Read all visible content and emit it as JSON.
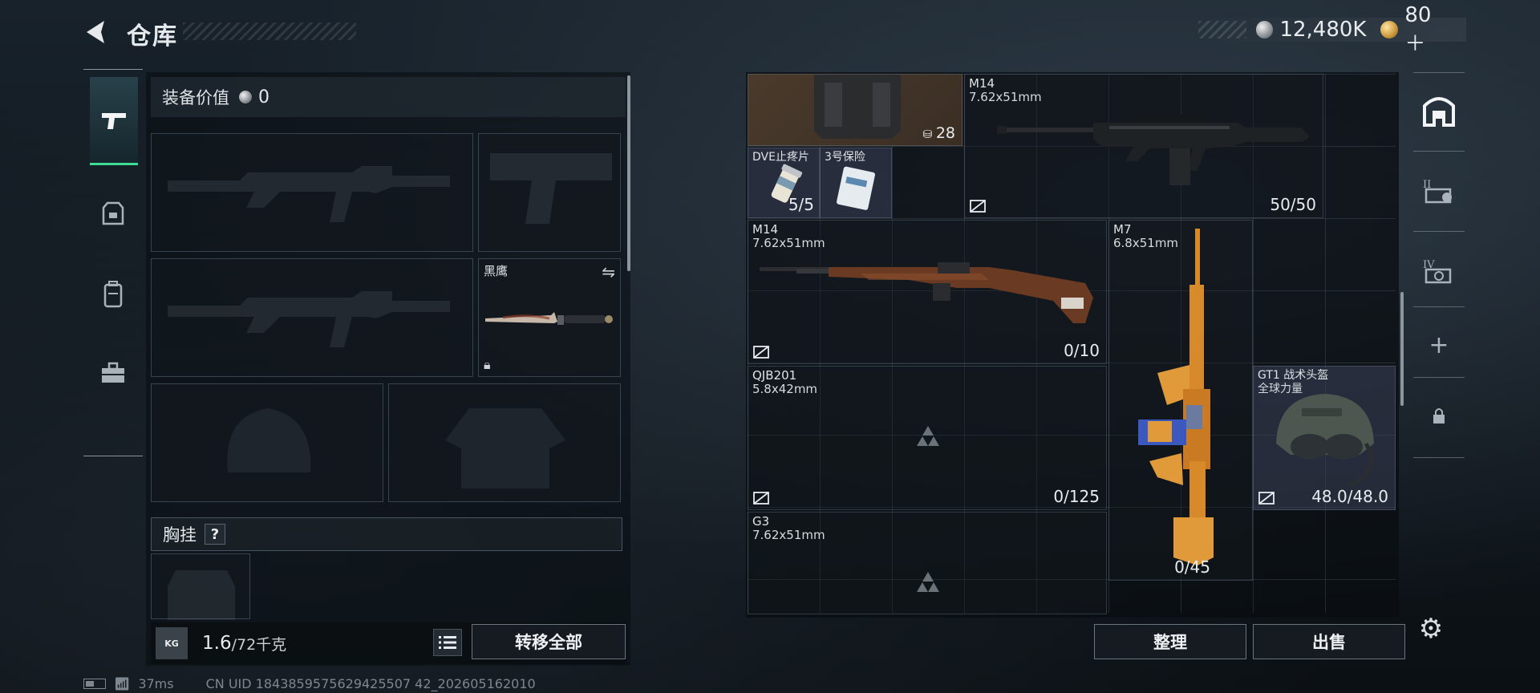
{
  "header": {
    "title": "仓库",
    "currency_silver": "12,480K",
    "currency_gold": "80＋"
  },
  "left_tabs": [
    {
      "icon": "pistol-icon",
      "active": true
    },
    {
      "icon": "armor-icon",
      "active": false
    },
    {
      "icon": "backpack-icon",
      "active": false
    },
    {
      "icon": "toolbox-icon",
      "active": false
    }
  ],
  "loadout": {
    "equipment_value_label": "装备价值",
    "equipment_value": "0",
    "melee_name": "黑鹰",
    "chest_rig_label": "胸挂",
    "help_label": "?",
    "weight_current": "1.6",
    "weight_max": "/72千克",
    "kg_label": "KG",
    "transfer_all": "转移全部"
  },
  "stash_items": {
    "backpack_count": "28",
    "m14_top": {
      "name": "M14",
      "caliber": "7.62x51mm",
      "ammo": "50/50"
    },
    "dve": {
      "name": "DVE止疼片",
      "count": "5/5"
    },
    "no3_safe": {
      "name": "3号保险"
    },
    "m14_wood": {
      "name": "M14",
      "caliber": "7.62x51mm",
      "ammo": "0/10"
    },
    "m7": {
      "name": "M7",
      "caliber": "6.8x51mm",
      "ammo": "0/45"
    },
    "qjb201": {
      "name": "QJB201",
      "caliber": "5.8x42mm",
      "ammo": "0/125"
    },
    "gt1": {
      "name": "GT1 战术头盔",
      "subtitle": "全球力量",
      "durability": "48.0/48.0"
    },
    "g3": {
      "name": "G3",
      "caliber": "7.62x51mm"
    }
  },
  "right_tabs": [
    "stash-main-icon",
    "stash-ii-icon",
    "stash-iv-icon",
    "add-icon",
    "lock-icon"
  ],
  "actions": {
    "sort": "整理",
    "sell": "出售"
  },
  "status_bar": {
    "ping": "37ms",
    "uid": "CN UID 1843859575629425507 42_202605162010"
  },
  "colors": {
    "accent": "#3fdc94",
    "m7_orange": "#d8892a"
  }
}
